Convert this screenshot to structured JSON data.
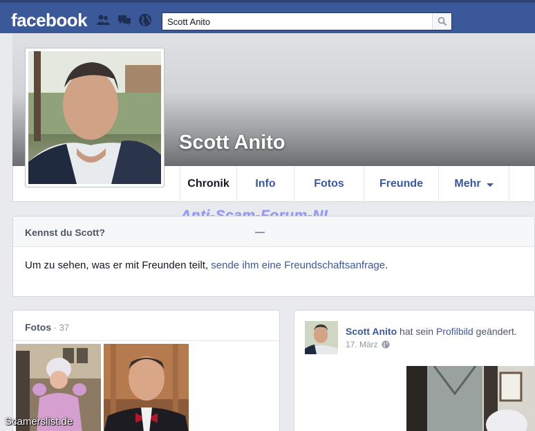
{
  "topbar": {
    "logo": "facebook",
    "search_value": "Scott Anito"
  },
  "profile": {
    "name": "Scott Anito"
  },
  "tabs": [
    {
      "label": "Chronik",
      "active": true
    },
    {
      "label": "Info"
    },
    {
      "label": "Fotos"
    },
    {
      "label": "Freunde"
    },
    {
      "label": "Mehr"
    }
  ],
  "watermark": "Anti-Scam-Forum-NL",
  "know_card": {
    "title": "Kennst du Scott?",
    "text_before": "Um zu sehen, was er mit Freunden teilt, ",
    "link": "sende ihm eine Freundschaftsanfrage",
    "text_after": "."
  },
  "photos_card": {
    "title": "Fotos",
    "count": " · 37"
  },
  "post": {
    "author": "Scott Anito",
    "text_1": " hat sein ",
    "link": "Profilbild",
    "text_2": " geändert.",
    "date": "17. März"
  },
  "footer_watermark": "Scamerslist.de",
  "colors": {
    "brand": "#3b5998",
    "page_bg": "#e9eaed"
  },
  "icons": [
    "friends-icon",
    "messages-icon",
    "globe-icon",
    "search-icon",
    "globe-small-icon"
  ]
}
